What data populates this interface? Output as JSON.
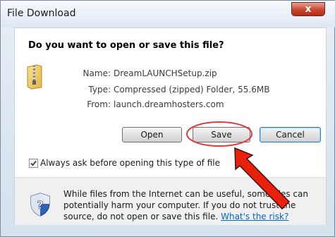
{
  "window": {
    "title": "File Download",
    "close_glyph": "x"
  },
  "dialog": {
    "heading": "Do you want to open or save this file?",
    "fields": {
      "name_label": "Name:",
      "name_value": "DreamLAUNCHSetup.zip",
      "type_label": "Type:",
      "type_value": "Compressed (zipped) Folder, 55.6MB",
      "from_label": "From:",
      "from_value": "launch.dreamhosters.com"
    },
    "buttons": {
      "open": "Open",
      "save": "Save",
      "cancel": "Cancel"
    },
    "checkbox": {
      "label": "Always ask before opening this type of file",
      "checked": true
    },
    "warning": {
      "text": "While files from the Internet can be useful, some files can potentially harm your computer. If you do not trust the source, do not open or save this file. ",
      "link": "What's the risk?"
    }
  },
  "annotation": {
    "highlight_color": "#e03a3a",
    "arrow_color": "#e8200c"
  },
  "icons": [
    "zip-folder-icon",
    "security-shield-icon",
    "close-icon",
    "checkmark-icon"
  ]
}
